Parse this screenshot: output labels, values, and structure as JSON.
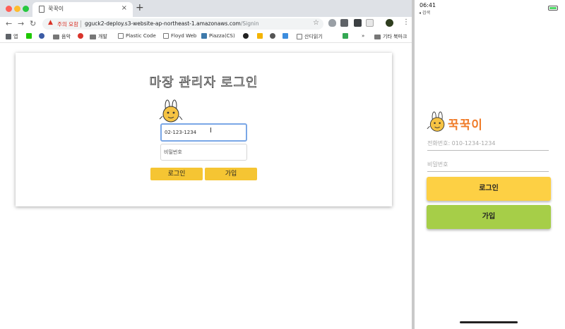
{
  "browser": {
    "tab_title": "꾹꾹이",
    "tab_close": "×",
    "new_tab": "+",
    "nav": {
      "back": "←",
      "forward": "→",
      "reload": "↻"
    },
    "omnibox": {
      "warning": "주의 요함",
      "url_host": "gguck2-deploy.s3-website-ap-northeast-1.amazonaws.com",
      "url_path": "/Signin"
    },
    "bookmarks": {
      "apps": "앱",
      "music": "음악",
      "dev": "개발",
      "plastic": "Plastic Code",
      "floyd": "Floyd Web",
      "piazza": "Piazza(CS)",
      "sandi": "산디읽기",
      "more": "»",
      "other": "기타 북마크"
    }
  },
  "web_page": {
    "title": "마장 관리자 로그인",
    "phone_value": "02-123-1234",
    "password_placeholder": "비밀번호",
    "login_label": "로그인",
    "signup_label": "가입"
  },
  "ipad": {
    "time": "06:41",
    "back_label": "◂ 검색",
    "app_name": "꾹꾹이",
    "phone_placeholder": "전화번호: 010-1234-1234",
    "password_placeholder": "비밀번호",
    "login_label": "로그인",
    "signup_label": "가입"
  },
  "colors": {
    "web_button": "#f5c533",
    "ipad_login": "#fdd044",
    "ipad_signup": "#a6ce48",
    "logo_text": "#f07c2a"
  }
}
